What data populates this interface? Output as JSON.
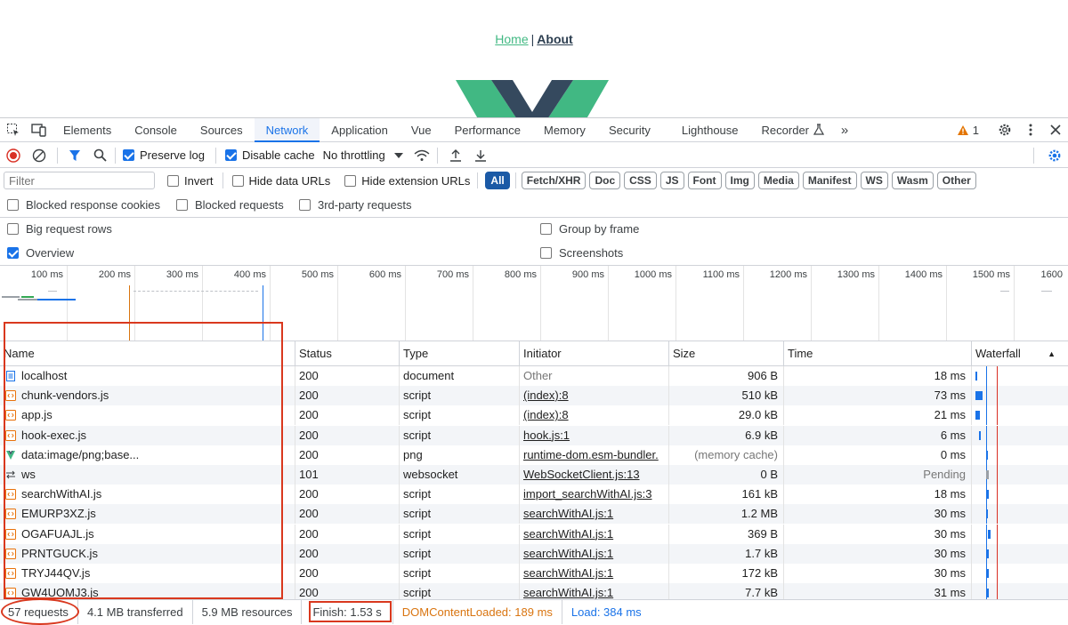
{
  "page": {
    "nav": {
      "home": "Home",
      "separator": "|",
      "about": "About"
    },
    "colors": {
      "link_home": "#42b983",
      "link_about": "#2c3e50",
      "logo_green": "#41b883",
      "logo_dark": "#35495e"
    }
  },
  "devtools": {
    "tabs": [
      "Elements",
      "Console",
      "Sources",
      "Network",
      "Application",
      "Vue",
      "Performance",
      "Memory",
      "Security",
      "Lighthouse",
      "Recorder"
    ],
    "active_tab": "Network",
    "warning_count": "1",
    "toolbar": {
      "preserve_log": "Preserve log",
      "disable_cache": "Disable cache",
      "throttling": "No throttling"
    },
    "filter": {
      "placeholder": "Filter",
      "invert": "Invert",
      "hide_data_urls": "Hide data URLs",
      "hide_extension_urls": "Hide extension URLs",
      "types": [
        "All",
        "Fetch/XHR",
        "Doc",
        "CSS",
        "JS",
        "Font",
        "Img",
        "Media",
        "Manifest",
        "WS",
        "Wasm",
        "Other"
      ]
    },
    "options": {
      "blocked_response_cookies": "Blocked response cookies",
      "blocked_requests": "Blocked requests",
      "third_party_requests": "3rd-party requests",
      "big_request_rows": "Big request rows",
      "group_by_frame": "Group by frame",
      "overview": "Overview",
      "screenshots": "Screenshots"
    },
    "overview_ticks": [
      "100 ms",
      "200 ms",
      "300 ms",
      "400 ms",
      "500 ms",
      "600 ms",
      "700 ms",
      "800 ms",
      "900 ms",
      "1000 ms",
      "1100 ms",
      "1200 ms",
      "1300 ms",
      "1400 ms",
      "1500 ms",
      "1600"
    ],
    "columns": [
      "Name",
      "Status",
      "Type",
      "Initiator",
      "Size",
      "Time",
      "Waterfall"
    ],
    "rows": [
      {
        "name": "localhost",
        "status": "200",
        "type": "document",
        "initiator": "Other",
        "size": "906 B",
        "time": "18 ms",
        "icon": "document-icon"
      },
      {
        "name": "chunk-vendors.js",
        "status": "200",
        "type": "script",
        "initiator": "(index):8",
        "size": "510 kB",
        "time": "73 ms",
        "icon": "script-icon"
      },
      {
        "name": "app.js",
        "status": "200",
        "type": "script",
        "initiator": "(index):8",
        "size": "29.0 kB",
        "time": "21 ms",
        "icon": "script-icon"
      },
      {
        "name": "hook-exec.js",
        "status": "200",
        "type": "script",
        "initiator": "hook.js:1",
        "size": "6.9 kB",
        "time": "6 ms",
        "icon": "script-icon"
      },
      {
        "name": "data:image/png;base...",
        "status": "200",
        "type": "png",
        "initiator": "runtime-dom.esm-bundler.",
        "size": "(memory cache)",
        "time": "0 ms",
        "icon": "image-icon"
      },
      {
        "name": "ws",
        "status": "101",
        "type": "websocket",
        "initiator": "WebSocketClient.js:13",
        "size": "0 B",
        "time": "Pending",
        "icon": "websocket-icon"
      },
      {
        "name": "searchWithAI.js",
        "status": "200",
        "type": "script",
        "initiator": "import_searchWithAI.js:3",
        "size": "161 kB",
        "time": "18 ms",
        "icon": "script-icon"
      },
      {
        "name": "EMURP3XZ.js",
        "status": "200",
        "type": "script",
        "initiator": "searchWithAI.js:1",
        "size": "1.2 MB",
        "time": "30 ms",
        "icon": "script-icon"
      },
      {
        "name": "OGAFUAJL.js",
        "status": "200",
        "type": "script",
        "initiator": "searchWithAI.js:1",
        "size": "369 B",
        "time": "30 ms",
        "icon": "script-icon"
      },
      {
        "name": "PRNTGUCK.js",
        "status": "200",
        "type": "script",
        "initiator": "searchWithAI.js:1",
        "size": "1.7 kB",
        "time": "30 ms",
        "icon": "script-icon"
      },
      {
        "name": "TRYJ44QV.js",
        "status": "200",
        "type": "script",
        "initiator": "searchWithAI.js:1",
        "size": "172 kB",
        "time": "30 ms",
        "icon": "script-icon"
      },
      {
        "name": "GW4UOMJ3.js",
        "status": "200",
        "type": "script",
        "initiator": "searchWithAI.js:1",
        "size": "7.7 kB",
        "time": "31 ms",
        "icon": "script-icon"
      }
    ],
    "status": {
      "requests": "57 requests",
      "transferred": "4.1 MB transferred",
      "resources": "5.9 MB resources",
      "finish": "Finish: 1.53 s",
      "dom_content_loaded": "DOMContentLoaded: 189 ms",
      "load": "Load: 384 ms"
    },
    "colors": {
      "accent": "#1a73e8",
      "dcl": "#d9740f",
      "load": "#1a73e8",
      "highlight": "#d9381e"
    }
  }
}
